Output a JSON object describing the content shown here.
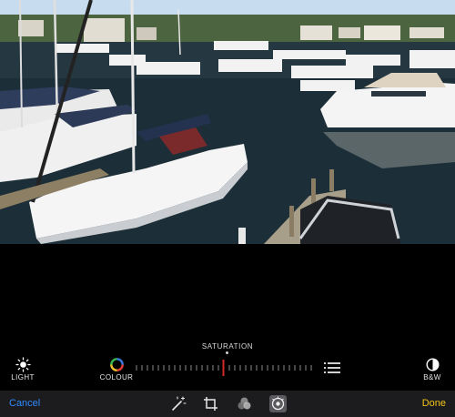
{
  "photo": {
    "subject": "marina-photo"
  },
  "adjustment": {
    "title": "SATURATION",
    "tools": [
      {
        "label": "LIGHT",
        "icon": "sun-icon"
      },
      {
        "label": "COLOUR",
        "icon": "colour-wheel-icon"
      },
      {
        "label": "B&W",
        "icon": "half-circle-icon"
      }
    ],
    "slider_value": 0.5,
    "list_icon": "list-icon"
  },
  "toolbar": {
    "cancel_label": "Cancel",
    "done_label": "Done",
    "icons": [
      "magic-wand-icon",
      "crop-rotate-icon",
      "filters-icon",
      "adjust-dial-icon"
    ],
    "active_icon": "adjust-dial-icon"
  },
  "colors": {
    "cancel": "#2f8cff",
    "done": "#f5c518",
    "slider_indicator": "#d62828",
    "toolbar_bg": "#1c1c1e"
  }
}
